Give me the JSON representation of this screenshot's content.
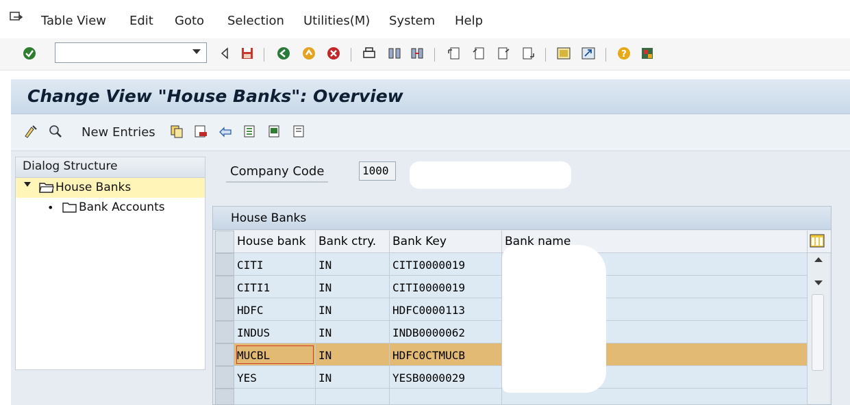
{
  "menu": {
    "items": [
      "Table View",
      "Edit",
      "Goto",
      "Selection",
      "Utilities(M)",
      "System",
      "Help"
    ]
  },
  "toolbar": {
    "command_field": "",
    "icons": [
      "enter-icon",
      "back-icon",
      "save-icon",
      "back-green-icon",
      "exit-icon",
      "cancel-icon",
      "print-icon",
      "find-icon",
      "find-next-icon",
      "first-page-icon",
      "previous-page-icon",
      "next-page-icon",
      "last-page-icon",
      "create-session-icon",
      "shortcut-icon",
      "help-icon",
      "customize-layout-icon"
    ]
  },
  "title": "Change View \"House Banks\": Overview",
  "app_toolbar": {
    "new_entries": "New Entries"
  },
  "dialog_structure": {
    "header": "Dialog Structure",
    "items": [
      {
        "label": "House Banks",
        "selected": true
      },
      {
        "label": "Bank Accounts",
        "selected": false
      }
    ]
  },
  "company_code": {
    "label": "Company Code",
    "value": "1000"
  },
  "table": {
    "title": "House Banks",
    "columns": [
      "House bank",
      "Bank ctry.",
      "Bank Key",
      "Bank name"
    ],
    "rows": [
      {
        "house_bank": "CITI",
        "country": "IN",
        "bank_key": "CITI0000019",
        "bank_name": ""
      },
      {
        "house_bank": "CITI1",
        "country": "IN",
        "bank_key": "CITI0000019",
        "bank_name": ""
      },
      {
        "house_bank": "HDFC",
        "country": "IN",
        "bank_key": "HDFC0000113",
        "bank_name": ""
      },
      {
        "house_bank": "INDUS",
        "country": "IN",
        "bank_key": "INDB0000062",
        "bank_name": ""
      },
      {
        "house_bank": "MUCBL",
        "country": "IN",
        "bank_key": "HDFC0CTMUCB",
        "bank_name": ""
      },
      {
        "house_bank": "YES",
        "country": "IN",
        "bank_key": "YESB0000029",
        "bank_name": ""
      }
    ],
    "highlight_color": "#e3ba73"
  }
}
